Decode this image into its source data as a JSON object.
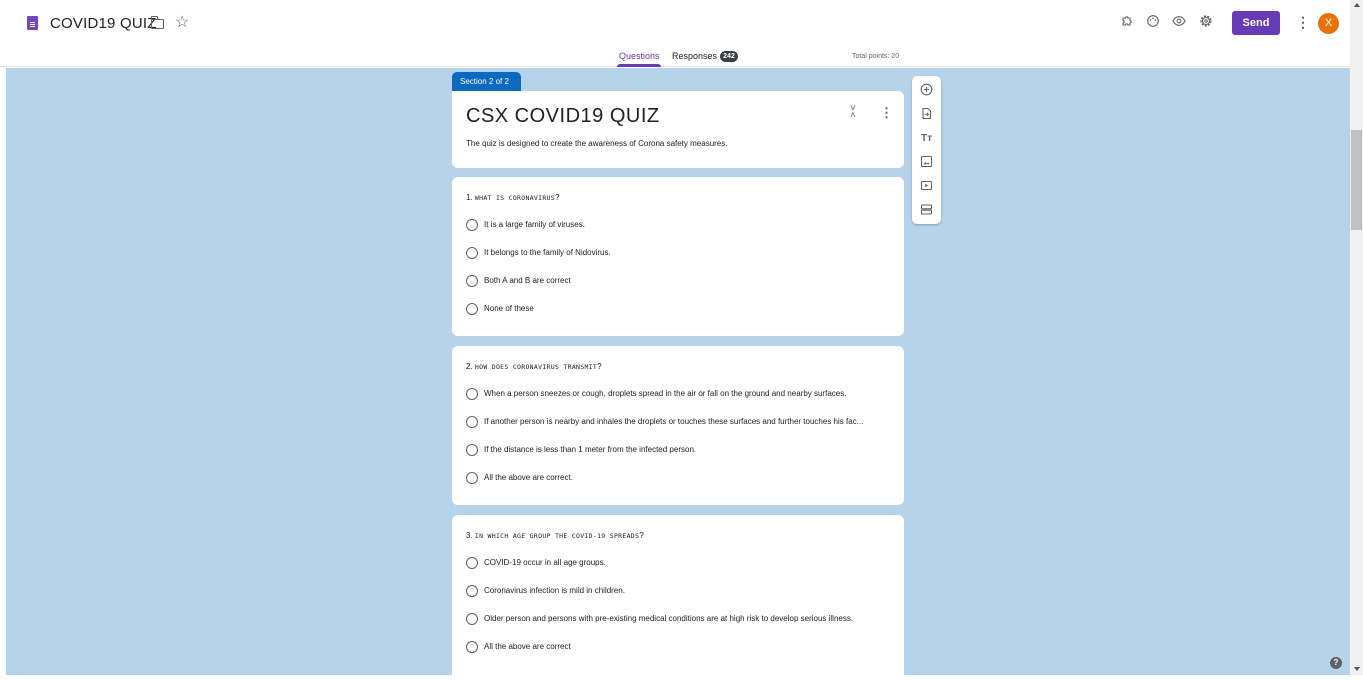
{
  "header": {
    "doc_title": "COVID19 QUIZ",
    "send_label": "Send",
    "avatar_letter": "X",
    "brand_color": "#673ab7",
    "avatar_color": "#e8710a"
  },
  "tabs": {
    "questions": "Questions",
    "responses": "Responses",
    "responses_count": "242",
    "total_points": "Total points: 20"
  },
  "form": {
    "section_label": "Section 2 of 2",
    "title": "CSX COVID19 QUIZ",
    "description": "The quiz is designed to create the awareness of Corona safety measures.",
    "canvas_color": "#b5d3eb"
  },
  "questions": [
    {
      "number": "1.",
      "text": "WHAT IS CORONAVIRUS",
      "suffix": "?",
      "options": [
        "It is a large family of viruses.",
        "It belongs to the family of Nidovirus.",
        "Both A and B are correct",
        "None of these"
      ]
    },
    {
      "number": "2.",
      "text": "HOW DOES CORONAVIRUS TRANSMIT",
      "suffix": "?",
      "options": [
        "When a person sneezes or cough, droplets spread in the air or fall on the ground and nearby surfaces.",
        "If another person is nearby and inhales the droplets or touches these surfaces and further touches his fac...",
        "If the distance is less than 1 meter from the infected person.",
        "All the above are correct."
      ]
    },
    {
      "number": "3.",
      "text": "IN WHICH AGE GROUP THE COVID-19 SPREADS",
      "suffix": "?",
      "options": [
        "COVID-19 occur in all age groups.",
        "Coronavirus infection is mild in children.",
        "Older person and persons with pre-existing medical conditions are at high risk to develop serious illness.",
        "All the above are correct"
      ]
    }
  ],
  "icons": {
    "toolbar": [
      "add-question-icon",
      "import-questions-icon",
      "add-title-icon",
      "add-image-icon",
      "add-video-icon",
      "add-section-icon"
    ],
    "header": [
      "addons-icon",
      "palette-icon",
      "preview-icon",
      "settings-icon",
      "more-vert-icon"
    ]
  }
}
